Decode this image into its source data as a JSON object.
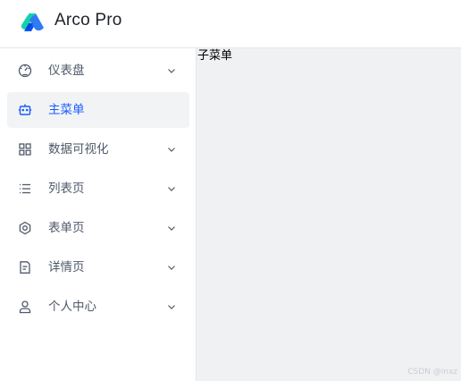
{
  "header": {
    "brand": "Arco Pro",
    "logo_icon": "arco-logo-icon",
    "logo_colors": [
      "#12d2ac",
      "#307af2",
      "#0057fe"
    ]
  },
  "sidebar": {
    "items": [
      {
        "label": "仪表盘",
        "icon": "dashboard-icon",
        "has_submenu": true,
        "active": false
      },
      {
        "label": "主菜单",
        "icon": "robot-icon",
        "has_submenu": false,
        "active": true
      },
      {
        "label": "数据可视化",
        "icon": "grid-icon",
        "has_submenu": true,
        "active": false
      },
      {
        "label": "列表页",
        "icon": "list-icon",
        "has_submenu": true,
        "active": false
      },
      {
        "label": "表单页",
        "icon": "settings-icon",
        "has_submenu": true,
        "active": false
      },
      {
        "label": "详情页",
        "icon": "file-icon",
        "has_submenu": true,
        "active": false
      },
      {
        "label": "个人中心",
        "icon": "user-icon",
        "has_submenu": true,
        "active": false
      }
    ]
  },
  "main": {
    "content_text": "子菜单"
  },
  "watermark": "CSDN @inxz",
  "colors": {
    "accent": "#165dff",
    "text": "#4e5969",
    "active_bg": "#f2f3f5",
    "content_bg": "#f0f1f3",
    "border": "#e5e6eb"
  }
}
